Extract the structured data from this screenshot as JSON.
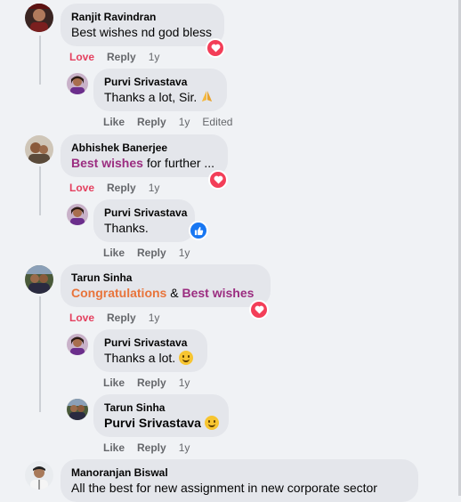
{
  "comments": [
    {
      "name": "Ranjit Ravindran",
      "text": "Best wishes nd god bless",
      "actions": {
        "reaction": "Love",
        "reply": "Reply",
        "time": "1y"
      },
      "reaction_badge": "heart-icon",
      "replies": [
        {
          "name": "Purvi Srivastava",
          "text": "Thanks a lot, Sir.",
          "emoji": "folded-hands-icon",
          "actions": {
            "like": "Like",
            "reply": "Reply",
            "time": "1y",
            "edited": "Edited"
          }
        }
      ]
    },
    {
      "name": "Abhishek Banerjee",
      "text_highlight": "Best wishes",
      "text_rest": " for further ...",
      "actions": {
        "reaction": "Love",
        "reply": "Reply",
        "time": "1y"
      },
      "reaction_badge": "heart-icon",
      "replies": [
        {
          "name": "Purvi Srivastava",
          "text": "Thanks.",
          "reaction_badge": "thumbs-up-icon",
          "actions": {
            "like": "Like",
            "reply": "Reply",
            "time": "1y"
          }
        }
      ]
    },
    {
      "name": "Tarun Sinha",
      "text_part1": "Congratulations",
      "text_part2": " & ",
      "text_part3": "Best wishes",
      "actions": {
        "reaction": "Love",
        "reply": "Reply",
        "time": "1y"
      },
      "reaction_badge": "heart-icon",
      "replies": [
        {
          "name": "Purvi Srivastava",
          "text": "Thanks a lot.",
          "emoji": "slightly-smiling-face-icon",
          "actions": {
            "like": "Like",
            "reply": "Reply",
            "time": "1y"
          }
        },
        {
          "name": "Tarun Sinha",
          "mention": "Purvi Srivastava",
          "emoji": "smiling-face-icon",
          "actions": {
            "like": "Like",
            "reply": "Reply",
            "time": "1y"
          }
        }
      ]
    },
    {
      "name": "Manoranjan Biswal",
      "text": "All the best for new assignment in new corporate sector"
    }
  ],
  "colors": {
    "love": "#e4405f",
    "purple_highlight": "#9b2d80",
    "orange_highlight": "#e8743b",
    "bubble": "#e4e6eb",
    "background": "#f0f2f5"
  }
}
